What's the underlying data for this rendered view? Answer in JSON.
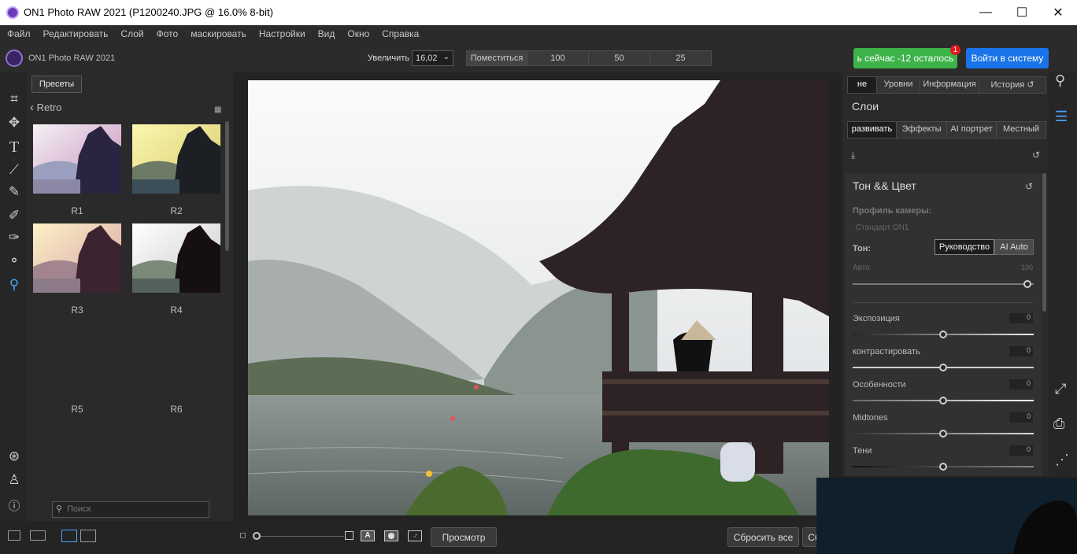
{
  "window": {
    "title": "ON1 Photo RAW 2021 (P1200240.JPG @ 16.0% 8-bit)",
    "minimize": "—",
    "maximize": "☐",
    "close": "✕"
  },
  "menu": [
    "Файл",
    "Редактировать",
    "Слой",
    "Фото",
    "маскировать",
    "Настройки",
    "Вид",
    "Окно",
    "Справка"
  ],
  "toolbar": {
    "app_name": "ON1 Photo RAW 2021",
    "zoom_label": "Увеличить",
    "zoom_value": "16,02",
    "fit_label": "Поместиться",
    "zoom_presets": [
      "100",
      "50",
      "25"
    ],
    "buy_label": "ь сейчас -12 осталось",
    "badge_count": "1",
    "login_label": "Войти в систему"
  },
  "presets": {
    "button": "Пресеты",
    "category": "Retro",
    "items": [
      "R1",
      "R2",
      "R3",
      "R4",
      "R5",
      "R6"
    ],
    "search_placeholder": "Поиск"
  },
  "right_panel": {
    "top_tabs": [
      "не",
      "Уровни",
      "Информация",
      "История"
    ],
    "layers_title": "Слои",
    "sub_tabs": [
      "развивать",
      "Эффекты",
      "AI портрет",
      "Местный"
    ],
    "section_title": "Тон && Цвет",
    "camera_profile_label": "Профиль камеры:",
    "camera_profile_value": "Стандарт ON1",
    "tone_label": "Тон:",
    "tone_modes": [
      "Руководство",
      "AI Auto"
    ],
    "auto_label": "Авто",
    "auto_value": "100",
    "sliders": [
      {
        "label": "Экспозиция",
        "value": "0"
      },
      {
        "label": "контрастировать",
        "value": "0"
      },
      {
        "label": "Особенности",
        "value": "0"
      },
      {
        "label": "Midtones",
        "value": "0"
      },
      {
        "label": "Тени",
        "value": "0"
      }
    ]
  },
  "bottom": {
    "preview_label": "Просмотр",
    "reset_all_label": "Сбросить все",
    "reset_label": "Сб"
  },
  "colors": {
    "accent_green": "#3db34a",
    "accent_blue": "#1a73e8",
    "badge_red": "#e0191d"
  }
}
